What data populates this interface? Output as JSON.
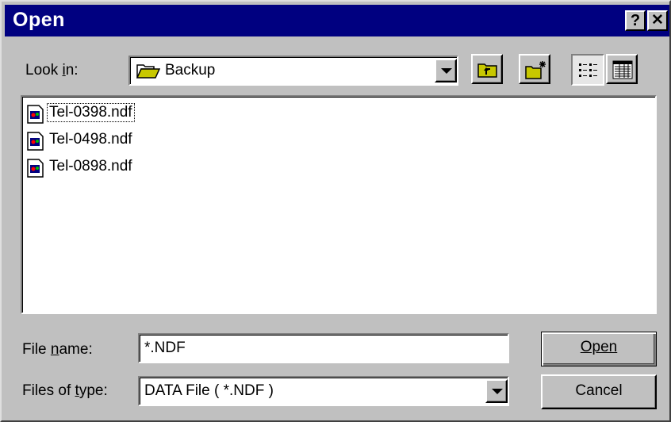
{
  "window": {
    "title": "Open",
    "help_glyph": "?",
    "close_glyph": "✕"
  },
  "look_in": {
    "label": "Look in:",
    "value": "Backup",
    "icon": "folder-open-icon"
  },
  "toolbar": {
    "buttons": [
      "up-one-level-icon",
      "create-new-folder-icon",
      "list-view-icon",
      "details-view-icon"
    ]
  },
  "files": [
    {
      "name": "Tel-0398.ndf",
      "icon": "data-file-icon"
    },
    {
      "name": "Tel-0498.ndf",
      "icon": "data-file-icon"
    },
    {
      "name": "Tel-0898.ndf",
      "icon": "data-file-icon"
    }
  ],
  "file_name": {
    "label": "File name:",
    "value": "*.NDF"
  },
  "file_type": {
    "label": "Files of type:",
    "value": "DATA File ( *.NDF )"
  },
  "buttons": {
    "open": "Open",
    "cancel": "Cancel"
  },
  "colors": {
    "titlebar": "#000080",
    "face": "#c0c0c0"
  }
}
